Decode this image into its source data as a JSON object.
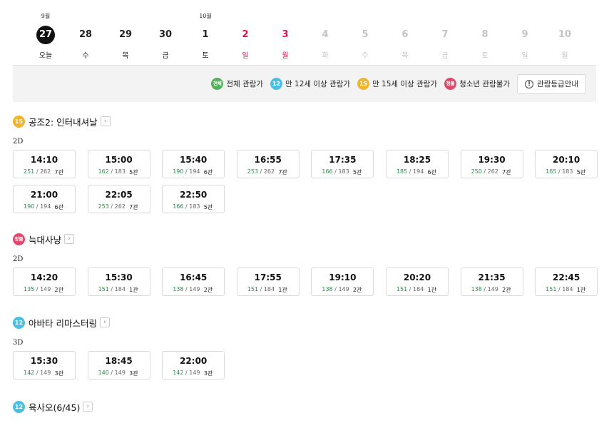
{
  "dates": [
    {
      "month": "9월",
      "day": "27",
      "dow": "오늘",
      "state": "today"
    },
    {
      "month": "",
      "day": "28",
      "dow": "수",
      "state": "normal"
    },
    {
      "month": "",
      "day": "29",
      "dow": "목",
      "state": "normal"
    },
    {
      "month": "",
      "day": "30",
      "dow": "금",
      "state": "normal"
    },
    {
      "month": "10월",
      "day": "1",
      "dow": "토",
      "state": "normal"
    },
    {
      "month": "",
      "day": "2",
      "dow": "일",
      "state": "red"
    },
    {
      "month": "",
      "day": "3",
      "dow": "월",
      "state": "red"
    },
    {
      "month": "",
      "day": "4",
      "dow": "화",
      "state": "dim"
    },
    {
      "month": "",
      "day": "5",
      "dow": "수",
      "state": "dim"
    },
    {
      "month": "",
      "day": "6",
      "dow": "목",
      "state": "dim"
    },
    {
      "month": "",
      "day": "7",
      "dow": "금",
      "state": "dim"
    },
    {
      "month": "",
      "day": "8",
      "dow": "토",
      "state": "dim"
    },
    {
      "month": "",
      "day": "9",
      "dow": "일",
      "state": "dim"
    },
    {
      "month": "",
      "day": "10",
      "dow": "월",
      "state": "dim"
    }
  ],
  "legend": {
    "all_badge": "전체",
    "all_label": "전체 관람가",
    "r12_badge": "12",
    "r12_label": "만 12세 이상 관람가",
    "r15_badge": "15",
    "r15_label": "만 15세 이상 관람가",
    "r18_badge": "청불",
    "r18_label": "청소년 관람불가",
    "guide_button": "관람등급안내",
    "guide_icon": "!"
  },
  "movies": [
    {
      "title": "공조2: 인터내셔날",
      "rating": "15",
      "rating_class": "b-15",
      "format": "2D",
      "sessions": [
        {
          "time": "14:10",
          "remain": "251",
          "total": "262",
          "hall": "7관"
        },
        {
          "time": "15:00",
          "remain": "162",
          "total": "183",
          "hall": "5관"
        },
        {
          "time": "15:40",
          "remain": "190",
          "total": "194",
          "hall": "6관"
        },
        {
          "time": "16:55",
          "remain": "253",
          "total": "262",
          "hall": "7관"
        },
        {
          "time": "17:35",
          "remain": "166",
          "total": "183",
          "hall": "5관"
        },
        {
          "time": "18:25",
          "remain": "185",
          "total": "194",
          "hall": "6관"
        },
        {
          "time": "19:30",
          "remain": "250",
          "total": "262",
          "hall": "7관"
        },
        {
          "time": "20:10",
          "remain": "165",
          "total": "183",
          "hall": "5관"
        },
        {
          "time": "21:00",
          "remain": "190",
          "total": "194",
          "hall": "6관"
        },
        {
          "time": "22:05",
          "remain": "253",
          "total": "262",
          "hall": "7관"
        },
        {
          "time": "22:50",
          "remain": "166",
          "total": "183",
          "hall": "5관"
        }
      ]
    },
    {
      "title": "늑대사냥",
      "rating": "청불",
      "rating_class": "b-18",
      "format": "2D",
      "sessions": [
        {
          "time": "14:20",
          "remain": "135",
          "total": "149",
          "hall": "2관"
        },
        {
          "time": "15:30",
          "remain": "151",
          "total": "184",
          "hall": "1관"
        },
        {
          "time": "16:45",
          "remain": "138",
          "total": "149",
          "hall": "2관"
        },
        {
          "time": "17:55",
          "remain": "151",
          "total": "184",
          "hall": "1관"
        },
        {
          "time": "19:10",
          "remain": "138",
          "total": "149",
          "hall": "2관"
        },
        {
          "time": "20:20",
          "remain": "151",
          "total": "184",
          "hall": "1관"
        },
        {
          "time": "21:35",
          "remain": "138",
          "total": "149",
          "hall": "2관"
        },
        {
          "time": "22:45",
          "remain": "151",
          "total": "184",
          "hall": "1관"
        }
      ]
    },
    {
      "title": "아바타 리마스터링",
      "rating": "12",
      "rating_class": "b-12",
      "format": "3D",
      "sessions": [
        {
          "time": "15:30",
          "remain": "142",
          "total": "149",
          "hall": "3관"
        },
        {
          "time": "18:45",
          "remain": "140",
          "total": "149",
          "hall": "3관"
        },
        {
          "time": "22:00",
          "remain": "142",
          "total": "149",
          "hall": "3관"
        }
      ]
    },
    {
      "title": "육사오(6/45)",
      "rating": "12",
      "rating_class": "b-12",
      "format": "",
      "sessions": []
    }
  ],
  "chevron": "›",
  "seat_separator": " / "
}
